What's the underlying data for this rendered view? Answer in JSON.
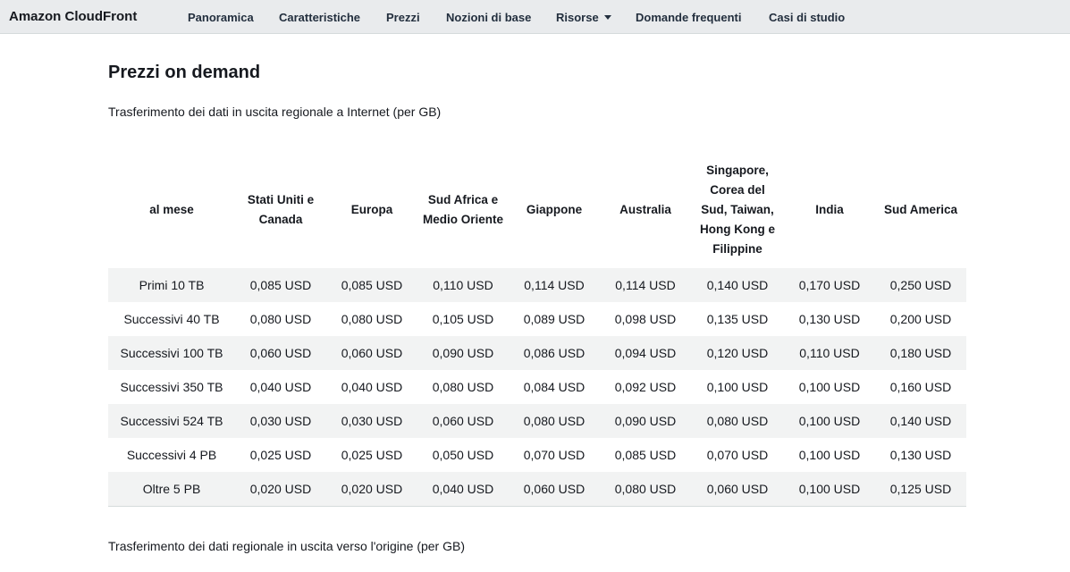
{
  "navbar": {
    "brand": "Amazon CloudFront",
    "items": [
      {
        "label": "Panoramica"
      },
      {
        "label": "Caratteristiche"
      },
      {
        "label": "Prezzi"
      },
      {
        "label": "Nozioni di base"
      },
      {
        "label": "Risorse"
      },
      {
        "label": "Domande frequenti"
      },
      {
        "label": "Casi di studio"
      }
    ]
  },
  "main": {
    "title": "Prezzi on demand",
    "subtitle": "Trasferimento dei dati in uscita regionale a Internet (per GB)",
    "footer_subtitle": "Trasferimento dei dati regionale in uscita verso l'origine (per GB)",
    "table": {
      "headers": [
        "al mese",
        "Stati Uniti e Canada",
        "Europa",
        "Sud Africa e Medio Oriente",
        "Giappone",
        "Australia",
        "Singapore, Corea del Sud, Taiwan, Hong Kong e Filippine",
        "India",
        "Sud America"
      ],
      "rows": [
        [
          "Primi 10 TB",
          "0,085 USD",
          "0,085 USD",
          "0,110 USD",
          "0,114 USD",
          "0,114 USD",
          "0,140 USD",
          "0,170 USD",
          "0,250 USD"
        ],
        [
          "Successivi 40 TB",
          "0,080 USD",
          "0,080 USD",
          "0,105 USD",
          "0,089 USD",
          "0,098 USD",
          "0,135 USD",
          "0,130 USD",
          "0,200 USD"
        ],
        [
          "Successivi 100 TB",
          "0,060 USD",
          "0,060 USD",
          "0,090 USD",
          "0,086 USD",
          "0,094 USD",
          "0,120 USD",
          "0,110 USD",
          "0,180 USD"
        ],
        [
          "Successivi 350 TB",
          "0,040 USD",
          "0,040 USD",
          "0,080 USD",
          "0,084 USD",
          "0,092 USD",
          "0,100 USD",
          "0,100 USD",
          "0,160 USD"
        ],
        [
          "Successivi 524 TB",
          "0,030 USD",
          "0,030 USD",
          "0,060 USD",
          "0,080 USD",
          "0,090 USD",
          "0,080 USD",
          "0,100 USD",
          "0,140 USD"
        ],
        [
          "Successivi 4 PB",
          "0,025 USD",
          "0,025 USD",
          "0,050 USD",
          "0,070 USD",
          "0,085 USD",
          "0,070 USD",
          "0,100 USD",
          "0,130 USD"
        ],
        [
          "Oltre 5 PB",
          "0,020 USD",
          "0,020 USD",
          "0,040 USD",
          "0,060 USD",
          "0,080 USD",
          "0,060 USD",
          "0,100 USD",
          "0,125 USD"
        ]
      ]
    }
  },
  "colors": {
    "navbar_bg": "#e9ebed",
    "stripe_bg": "#f2f3f3",
    "text": "#16191f"
  }
}
